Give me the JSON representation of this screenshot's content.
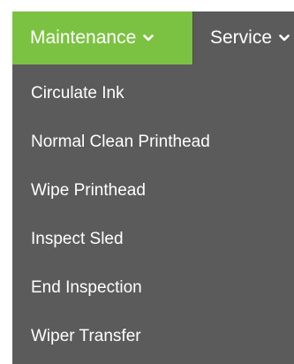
{
  "nav": {
    "tabs": [
      {
        "label": "Maintenance",
        "active": true,
        "color": "#7cc242"
      },
      {
        "label": "Service",
        "active": false
      }
    ],
    "background": "#5b5b5b"
  },
  "dropdown": {
    "items": [
      {
        "label": "Circulate Ink"
      },
      {
        "label": "Normal Clean Printhead"
      },
      {
        "label": "Wipe Printhead"
      },
      {
        "label": "Inspect Sled"
      },
      {
        "label": "End Inspection"
      },
      {
        "label": "Wiper Transfer"
      }
    ]
  }
}
